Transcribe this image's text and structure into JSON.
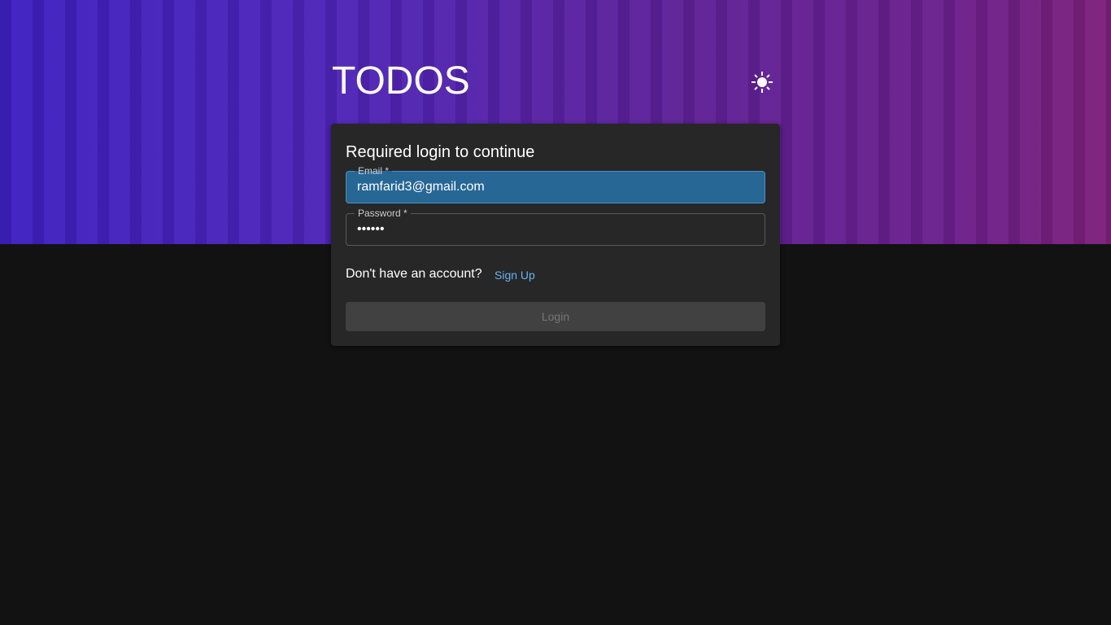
{
  "header": {
    "title": "TODOS",
    "theme_icon": "sun-icon"
  },
  "login": {
    "heading": "Required login to continue",
    "email_label": "Email *",
    "email_value": "ramfarid3@gmail.com",
    "password_label": "Password *",
    "password_value": "••••••",
    "account_prompt": "Don't have an account?",
    "signup_label": "Sign Up",
    "login_label": "Login"
  }
}
